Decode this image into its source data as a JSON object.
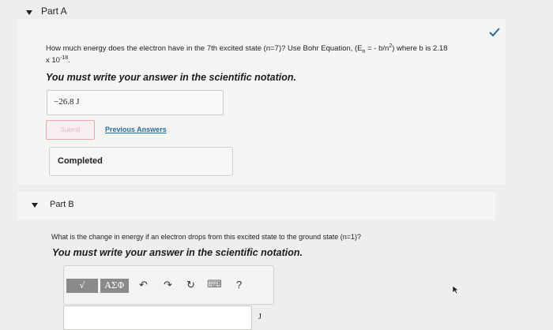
{
  "partA": {
    "label": "Part A",
    "question_main": "How much energy does the electron have in the 7th excited state (n=7)? Use Bohr Equation, (E",
    "question_sub_n": "n",
    "question_mid": " = - b/n",
    "question_sup2": "2",
    "question_end": ") where b is 2.18",
    "question_line2_pre": "x 10",
    "question_line2_exp": "-18",
    "question_line2_end": ".",
    "instruction": "You must write your answer in the scientific notation.",
    "answer": "−26.8  J",
    "submit_label": "Submit",
    "previous_answers_label": "Previous Answers",
    "completed_label": "Completed"
  },
  "partB": {
    "label": "Part B",
    "question": "What is the change in energy if an electron drops from this excited state to the ground state (n=1)?",
    "instruction": "You must write your answer in the scientific notation.",
    "unit": "J",
    "toolbar": {
      "templates_label": "√",
      "symbols_label": "AΣΦ",
      "undo_icon": "↶",
      "redo_icon": "↷",
      "reset_icon": "↻",
      "keyboard_icon": "⌨",
      "help_label": "?"
    }
  },
  "colors": {
    "checkmark": "#2c6e9b",
    "link": "#2c6e9b",
    "submit_border": "#e7a8b2"
  }
}
